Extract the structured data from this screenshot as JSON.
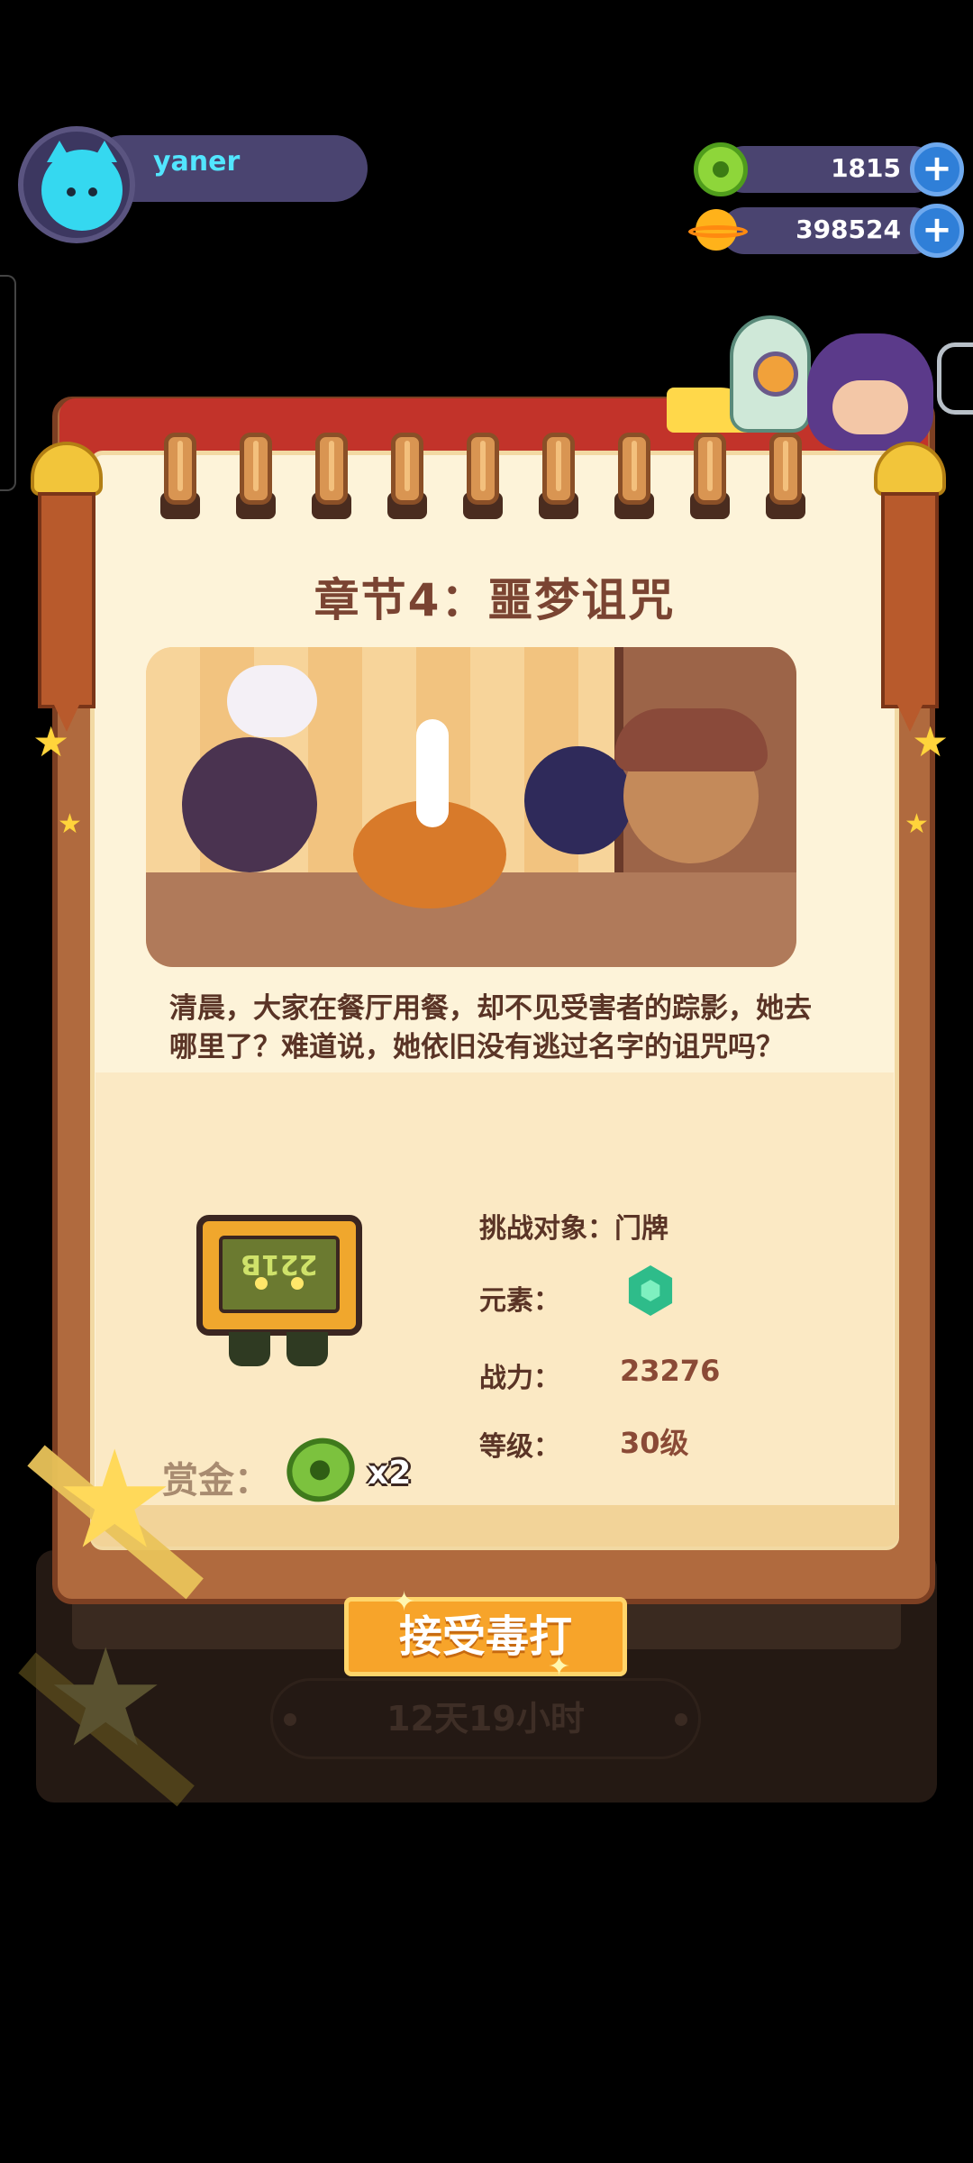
{
  "profile": {
    "username": "yaner",
    "avatar_icon": "cat-face-icon"
  },
  "currencies": [
    {
      "icon": "green-coin-icon",
      "value": "1815",
      "add_label": "+"
    },
    {
      "icon": "planet-coin-icon",
      "value": "398524",
      "add_label": "+"
    }
  ],
  "chapter": {
    "title": "章节4：噩梦诅咒",
    "story": "清晨，大家在餐厅用餐，却不见受害者的踪影，她去哪里了？难道说，她依旧没有逃过名字的诅咒吗？"
  },
  "target": {
    "sign_text": "221B",
    "challenge_label": "挑战对象：",
    "challenge_value": "门牌",
    "element_label": "元素：",
    "element_icon": "green-hexagon-gem-icon",
    "power_label": "战力：",
    "power_value": "23276",
    "level_label": "等级：",
    "level_value": "30级"
  },
  "reward": {
    "label": "赏金：",
    "icon": "green-coin-icon",
    "count": "x2"
  },
  "actions": {
    "accept_label": "接受毒打",
    "timer": "12天19小时"
  },
  "colors": {
    "background": "#000000",
    "title": "#7a4432",
    "text": "#5a3426",
    "accept_button": "#f7a42a",
    "username": "#52e6ff"
  }
}
